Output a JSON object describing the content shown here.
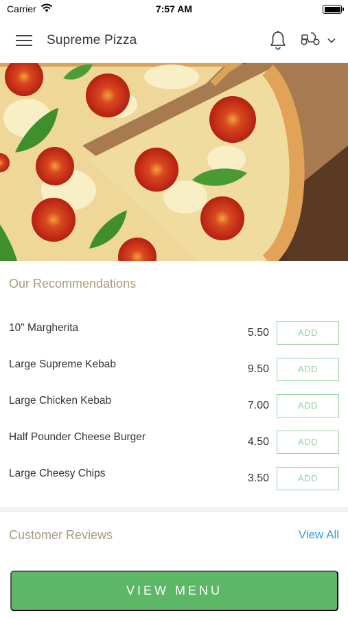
{
  "status_bar": {
    "carrier": "Carrier",
    "time": "7:57 AM"
  },
  "header": {
    "title": "Supreme Pizza",
    "icons": [
      "hamburger-menu-icon",
      "bell-icon",
      "scooter-icon",
      "chevron-down-icon"
    ]
  },
  "hero": {
    "image": "pizza-photo"
  },
  "recommendations": {
    "title": "Our Recommendations",
    "items": [
      {
        "name": "10\" Margherita",
        "price": "5.50",
        "add_label": "ADD"
      },
      {
        "name": "Large Supreme Kebab",
        "price": "9.50",
        "add_label": "ADD"
      },
      {
        "name": "Large Chicken Kebab",
        "price": "7.00",
        "add_label": "ADD"
      },
      {
        "name": "Half Pounder Cheese Burger",
        "price": "4.50",
        "add_label": "ADD"
      },
      {
        "name": "Large Cheesy Chips",
        "price": "3.50",
        "add_label": "ADD"
      }
    ]
  },
  "reviews": {
    "title": "Customer Reviews",
    "view_all": "View All"
  },
  "view_menu_label": "VIEW MENU",
  "colors": {
    "accent_green": "#5cb766",
    "add_outline": "#94d3a0",
    "section_title": "#a99b7c",
    "link_blue": "#2a9fd6"
  }
}
